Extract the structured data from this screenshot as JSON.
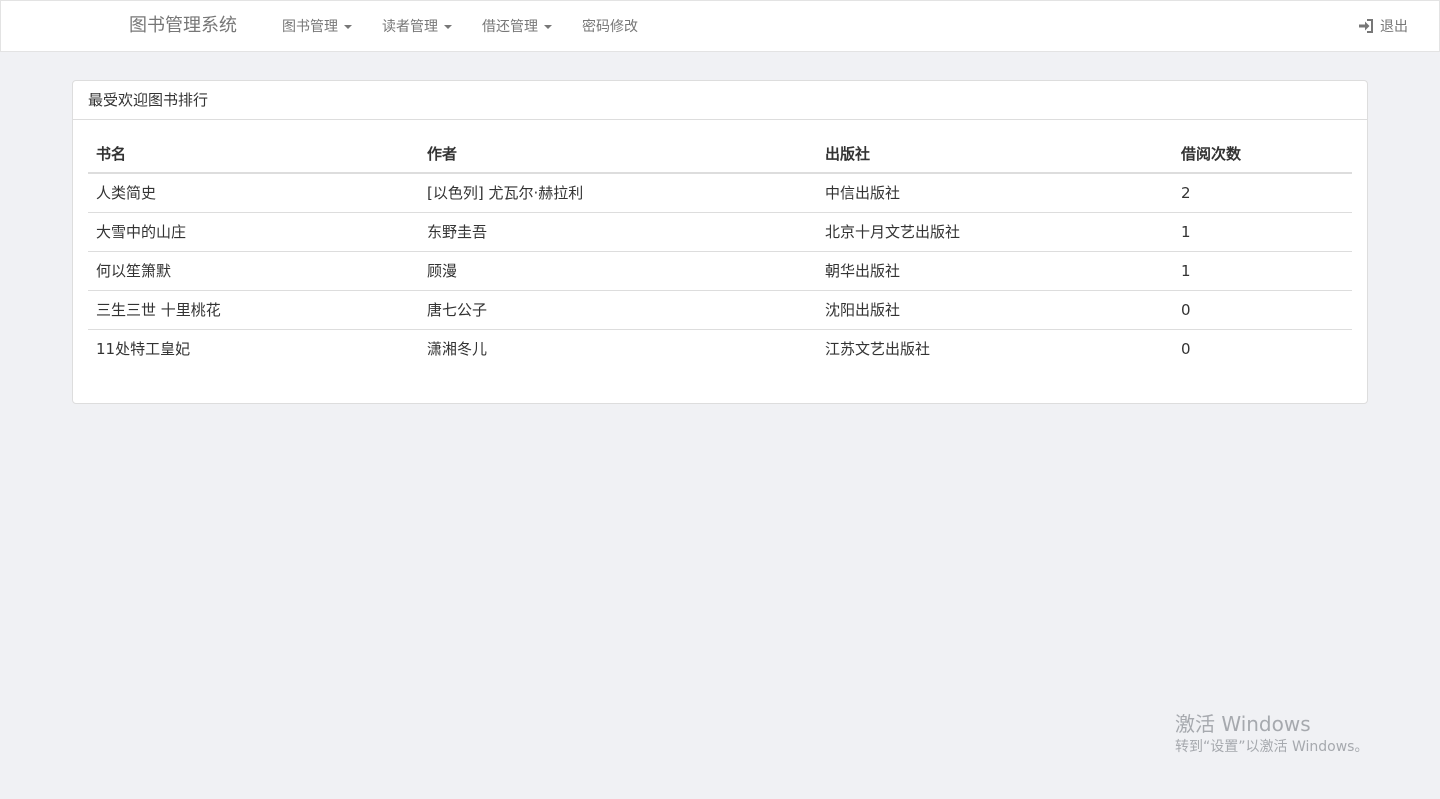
{
  "navbar": {
    "brand": "图书管理系统",
    "items": [
      {
        "label": "图书管理",
        "dropdown": true
      },
      {
        "label": "读者管理",
        "dropdown": true
      },
      {
        "label": "借还管理",
        "dropdown": true
      },
      {
        "label": "密码修改",
        "dropdown": false
      }
    ],
    "logout": {
      "label": "退出",
      "icon": "sign-in-icon"
    }
  },
  "panel": {
    "title": "最受欢迎图书排行",
    "table": {
      "headers": [
        "书名",
        "作者",
        "出版社",
        "借阅次数"
      ],
      "rows": [
        [
          "人类简史",
          "[以色列] 尤瓦尔·赫拉利",
          "中信出版社",
          "2"
        ],
        [
          "大雪中的山庄",
          "东野圭吾",
          "北京十月文艺出版社",
          "1"
        ],
        [
          "何以笙箫默",
          "顾漫",
          "朝华出版社",
          "1"
        ],
        [
          "三生三世 十里桃花",
          "唐七公子",
          "沈阳出版社",
          "0"
        ],
        [
          "11处特工皇妃",
          "潇湘冬儿",
          "江苏文艺出版社",
          "0"
        ]
      ]
    }
  },
  "watermark": {
    "title": "激活 Windows",
    "subtitle": "转到“设置”以激活 Windows。"
  },
  "colors": {
    "background": "#f0f1f4",
    "navbar_bg": "#ffffff",
    "nav_text": "#777777",
    "border": "#dddddd",
    "text": "#333333"
  }
}
